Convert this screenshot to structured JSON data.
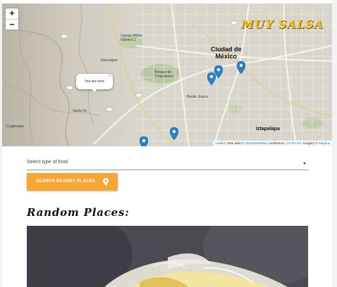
{
  "brand": {
    "name": "MUY SALSA",
    "color": "#f3c21f"
  },
  "map": {
    "zoom_in": "+",
    "zoom_out": "−",
    "city_label": "Ciudad de\nMéxico",
    "district_label": "Iztapalapa",
    "popup_text": "You are here",
    "popup_close": "×",
    "attribution_prefix": "Leaflet",
    "attribution_middle": " | Map data © ",
    "attribution_osm": "OpenStreetMap",
    "attribution_contrib": " contributors, ",
    "attribution_license": "CC-BY-SA",
    "attribution_imagery": ", Imagery © ",
    "attribution_mapbox": "Mapbox",
    "marker_color": "#2a81cb",
    "small_labels": [
      "Campo Militar Número 1",
      "Bosque de Chapultepec",
      "Naucalpan",
      "Santa Fe",
      "Cuajimalpa",
      "Benito Juárez"
    ]
  },
  "filters": {
    "food_select_value": "Select type of food"
  },
  "search_button": {
    "label": "SEARCH NEARBY PLACES",
    "icon": "map-pin-icon",
    "color": "#f7a535"
  },
  "random_section": {
    "title": "Random Places:"
  }
}
